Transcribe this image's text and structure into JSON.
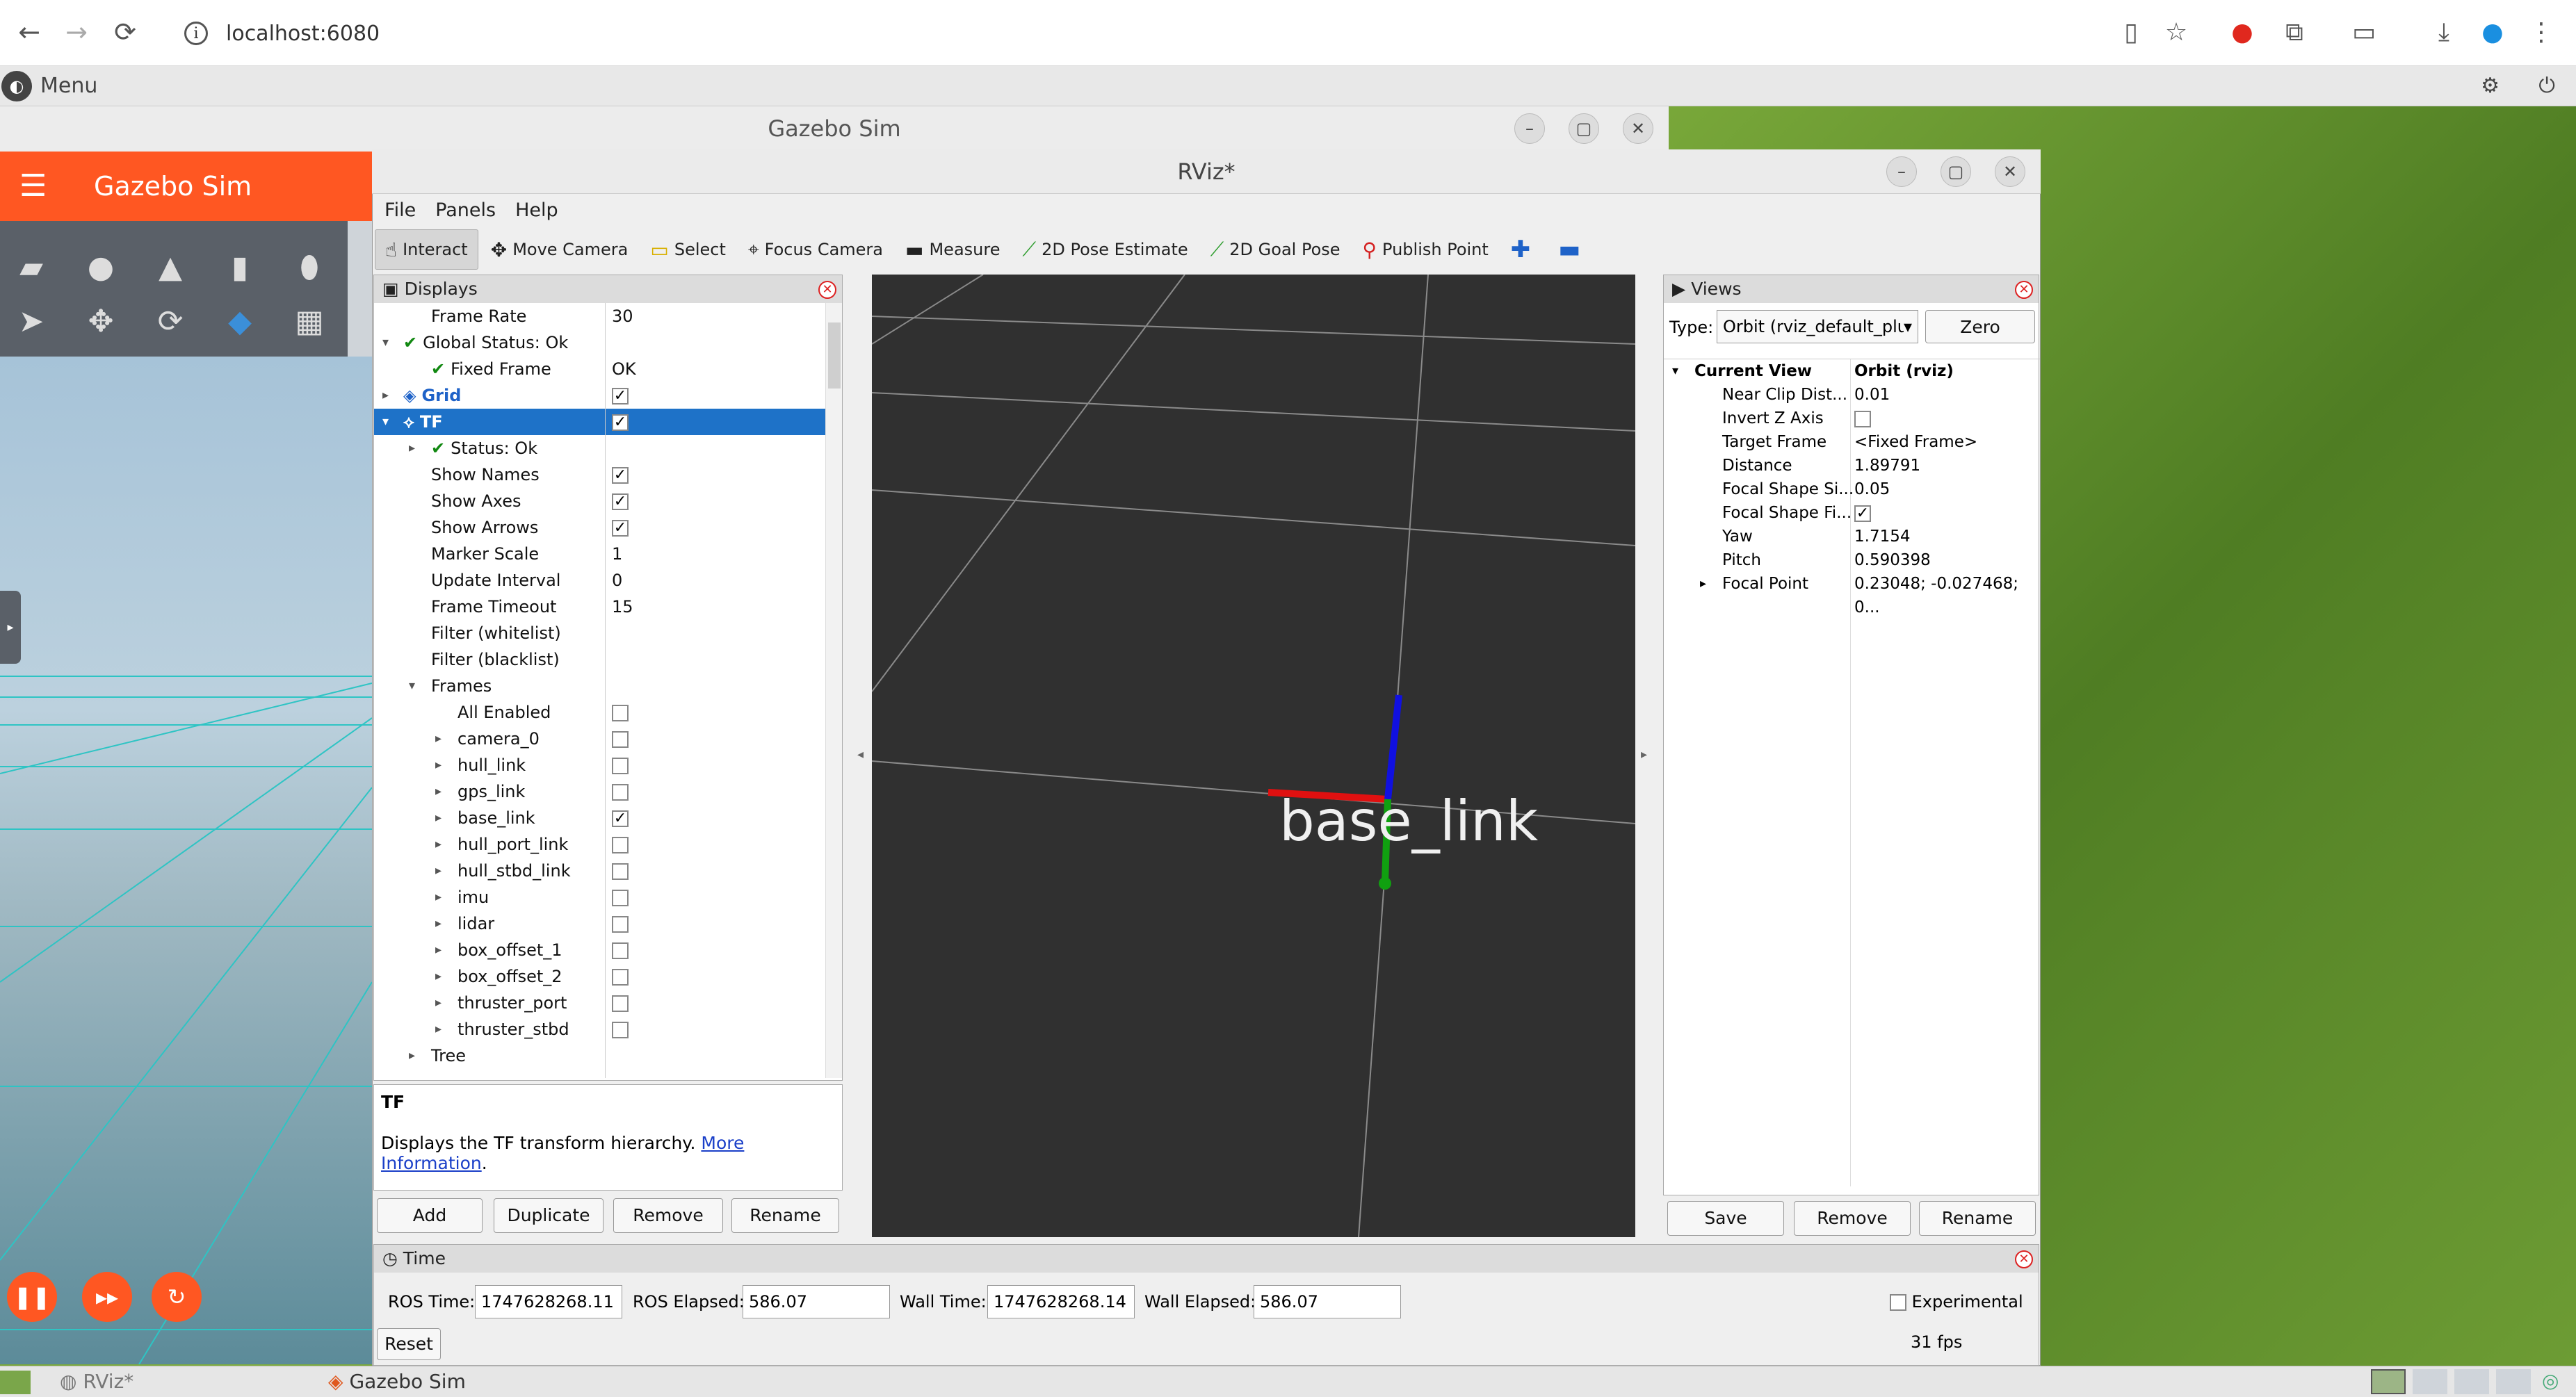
{
  "browser": {
    "url": "localhost:6080",
    "back_icon": "←",
    "forward_icon": "→",
    "reload_icon": "⟳"
  },
  "desktop_menu": {
    "label": "Menu"
  },
  "gazebo": {
    "window_title": "Gazebo Sim",
    "app_title": "Gazebo Sim",
    "accent": "#ff5722"
  },
  "rviz": {
    "window_title": "RViz*",
    "menus": [
      "File",
      "Panels",
      "Help"
    ],
    "tools": [
      "Interact",
      "Move Camera",
      "Select",
      "Focus Camera",
      "Measure",
      "2D Pose Estimate",
      "2D Goal Pose",
      "Publish Point"
    ],
    "displays": {
      "title": "Displays",
      "rows": [
        {
          "label": "Frame Rate",
          "value": "30"
        },
        {
          "label": "Global Status: Ok",
          "value": ""
        },
        {
          "label": "Fixed Frame",
          "value": "OK"
        },
        {
          "label": "Grid",
          "value": ""
        },
        {
          "label": "TF",
          "value": ""
        },
        {
          "label": "Status: Ok",
          "value": ""
        },
        {
          "label": "Show Names",
          "value": ""
        },
        {
          "label": "Show Axes",
          "value": ""
        },
        {
          "label": "Show Arrows",
          "value": ""
        },
        {
          "label": "Marker Scale",
          "value": "1"
        },
        {
          "label": "Update Interval",
          "value": "0"
        },
        {
          "label": "Frame Timeout",
          "value": "15"
        },
        {
          "label": "Filter (whitelist)",
          "value": ""
        },
        {
          "label": "Filter (blacklist)",
          "value": ""
        },
        {
          "label": "Frames",
          "value": ""
        },
        {
          "label": "All Enabled",
          "value": ""
        },
        {
          "label": "camera_0",
          "value": ""
        },
        {
          "label": "hull_link",
          "value": ""
        },
        {
          "label": "gps_link",
          "value": ""
        },
        {
          "label": "base_link",
          "value": ""
        },
        {
          "label": "hull_port_link",
          "value": ""
        },
        {
          "label": "hull_stbd_link",
          "value": ""
        },
        {
          "label": "imu",
          "value": ""
        },
        {
          "label": "lidar",
          "value": ""
        },
        {
          "label": "box_offset_1",
          "value": ""
        },
        {
          "label": "box_offset_2",
          "value": ""
        },
        {
          "label": "thruster_port",
          "value": ""
        },
        {
          "label": "thruster_stbd",
          "value": ""
        },
        {
          "label": "Tree",
          "value": ""
        }
      ],
      "description_title": "TF",
      "description_text": "Displays the TF transform hierarchy.",
      "description_link": "More Information",
      "description_end": ".",
      "buttons": [
        "Add",
        "Duplicate",
        "Remove",
        "Rename"
      ]
    },
    "viewport": {
      "frame_label": "base_link"
    },
    "views": {
      "title": "Views",
      "type_label": "Type:",
      "type_value": "Orbit (rviz_default_plu",
      "zero_label": "Zero",
      "rows": [
        {
          "key": "Current View",
          "value": "Orbit (rviz)"
        },
        {
          "key": "Near Clip Dist...",
          "value": "0.01"
        },
        {
          "key": "Invert Z Axis",
          "value": ""
        },
        {
          "key": "Target Frame",
          "value": "<Fixed Frame>"
        },
        {
          "key": "Distance",
          "value": "1.89791"
        },
        {
          "key": "Focal Shape Si...",
          "value": "0.05"
        },
        {
          "key": "Focal Shape Fi...",
          "value": ""
        },
        {
          "key": "Yaw",
          "value": "1.7154"
        },
        {
          "key": "Pitch",
          "value": "0.590398"
        },
        {
          "key": "Focal Point",
          "value": "0.23048; -0.027468; 0..."
        }
      ],
      "buttons": [
        "Save",
        "Remove",
        "Rename"
      ]
    },
    "time": {
      "title": "Time",
      "ros_time_label": "ROS Time:",
      "ros_time": "1747628268.11",
      "ros_elapsed_label": "ROS Elapsed:",
      "ros_elapsed": "586.07",
      "wall_time_label": "Wall Time:",
      "wall_time": "1747628268.14",
      "wall_elapsed_label": "Wall Elapsed:",
      "wall_elapsed": "586.07",
      "experimental_label": "Experimental",
      "reset_label": "Reset",
      "fps": "31 fps"
    }
  },
  "taskbar": {
    "items": [
      "RViz*",
      "Gazebo Sim"
    ]
  }
}
